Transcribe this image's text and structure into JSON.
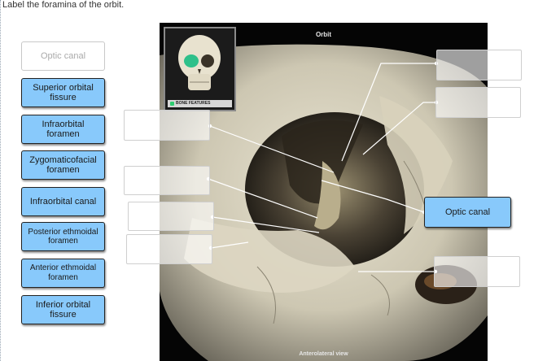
{
  "prompt": "Label the foramina of the orbit.",
  "figure": {
    "title": "Orbit",
    "caption": "Anterolateral view",
    "thumbnail_label": "BONE FEATURES"
  },
  "label_bank": [
    {
      "label": "Optic canal",
      "state": "used"
    },
    {
      "label": "Superior orbital fissure",
      "state": "available"
    },
    {
      "label": "Infraorbital foramen",
      "state": "available"
    },
    {
      "label": "Zygomaticofacial foramen",
      "state": "available"
    },
    {
      "label": "Infraorbital canal",
      "state": "available"
    },
    {
      "label": "Posterior ethmoidal foramen",
      "state": "available"
    },
    {
      "label": "Anterior ethmoidal foramen",
      "state": "available"
    },
    {
      "label": "Inferior orbital fissure",
      "state": "available"
    }
  ],
  "targets": [
    {
      "label": ""
    },
    {
      "label": ""
    },
    {
      "label": ""
    },
    {
      "label": ""
    },
    {
      "label": ""
    },
    {
      "label": ""
    },
    {
      "label": "Optic canal"
    },
    {
      "label": ""
    }
  ],
  "colors": {
    "label_fill": "#88c9fb",
    "label_border": "#222222",
    "used_text": "#aaaaaa"
  }
}
